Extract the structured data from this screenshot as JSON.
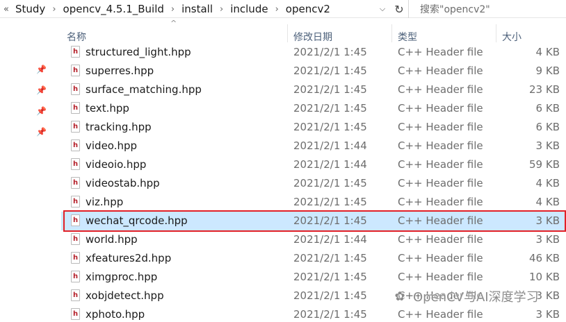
{
  "address_bar": {
    "nav_prefix": "«",
    "crumbs": [
      "Study",
      "opencv_4.5.1_Build",
      "install",
      "include",
      "opencv2"
    ],
    "separator": "›",
    "dropdown_glyph": "⌵",
    "refresh_glyph": "↻"
  },
  "search": {
    "placeholder": "搜索\"opencv2\""
  },
  "columns": {
    "name": "名称",
    "date": "修改日期",
    "type": "类型",
    "size": "大小",
    "sort_glyph": "^"
  },
  "pin_glyph": "📌",
  "files": [
    {
      "name": "structured_light.hpp",
      "date": "2021/2/1 1:45",
      "type": "C++ Header file",
      "size": "4 KB"
    },
    {
      "name": "superres.hpp",
      "date": "2021/2/1 1:45",
      "type": "C++ Header file",
      "size": "9 KB"
    },
    {
      "name": "surface_matching.hpp",
      "date": "2021/2/1 1:45",
      "type": "C++ Header file",
      "size": "23 KB"
    },
    {
      "name": "text.hpp",
      "date": "2021/2/1 1:45",
      "type": "C++ Header file",
      "size": "6 KB"
    },
    {
      "name": "tracking.hpp",
      "date": "2021/2/1 1:45",
      "type": "C++ Header file",
      "size": "6 KB"
    },
    {
      "name": "video.hpp",
      "date": "2021/2/1 1:44",
      "type": "C++ Header file",
      "size": "3 KB"
    },
    {
      "name": "videoio.hpp",
      "date": "2021/2/1 1:44",
      "type": "C++ Header file",
      "size": "59 KB"
    },
    {
      "name": "videostab.hpp",
      "date": "2021/2/1 1:45",
      "type": "C++ Header file",
      "size": "4 KB"
    },
    {
      "name": "viz.hpp",
      "date": "2021/2/1 1:45",
      "type": "C++ Header file",
      "size": "4 KB"
    },
    {
      "name": "wechat_qrcode.hpp",
      "date": "2021/2/1 1:45",
      "type": "C++ Header file",
      "size": "3 KB",
      "selected": true
    },
    {
      "name": "world.hpp",
      "date": "2021/2/1 1:44",
      "type": "C++ Header file",
      "size": "3 KB"
    },
    {
      "name": "xfeatures2d.hpp",
      "date": "2021/2/1 1:45",
      "type": "C++ Header file",
      "size": "46 KB"
    },
    {
      "name": "ximgproc.hpp",
      "date": "2021/2/1 1:45",
      "type": "C++ Header file",
      "size": "10 KB"
    },
    {
      "name": "xobjdetect.hpp",
      "date": "2021/2/1 1:45",
      "type": "C++ Header file",
      "size": "3 KB"
    },
    {
      "name": "xphoto.hpp",
      "date": "2021/2/1 1:45",
      "type": "C++ Header file",
      "size": "3 KB"
    }
  ],
  "file_icon_glyph": "h",
  "watermark": {
    "logo_glyph": "✿",
    "text": "OpenCV与AI深度学习"
  },
  "colors": {
    "selection": "#cce8ff",
    "highlight_border": "#e21f26",
    "header_text": "#4c607a",
    "icon_h": "#b5202a"
  }
}
